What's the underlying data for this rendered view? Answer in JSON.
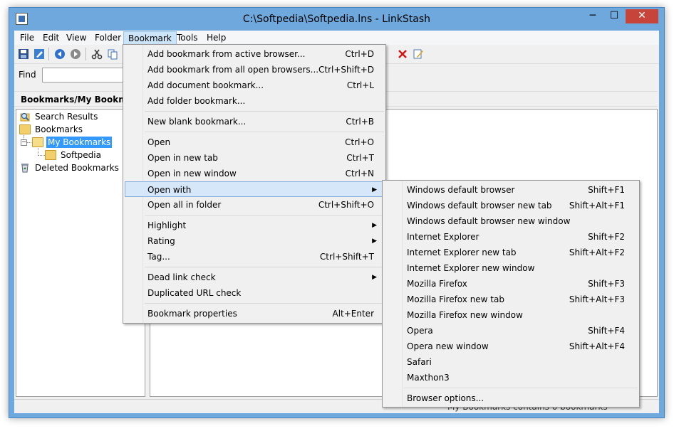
{
  "window": {
    "title": "C:\\Softpedia\\Softpedia.lns - LinkStash",
    "min_glyph": "─",
    "max_glyph": "☐",
    "close_glyph": "✕"
  },
  "menubar": [
    "File",
    "Edit",
    "View",
    "Folder",
    "Bookmark",
    "Tools",
    "Help"
  ],
  "toolbar": {
    "icons": [
      "save-icon",
      "properties-icon",
      "back-icon",
      "forward-icon",
      "cut-icon",
      "copy-icon",
      "delete-icon",
      "edit-icon"
    ]
  },
  "find": {
    "label": "Find",
    "value": ""
  },
  "tree": {
    "header": "Bookmarks/My Bookmarks",
    "items": [
      {
        "label": "Search Results",
        "icon": "search-icon"
      },
      {
        "label": "Bookmarks",
        "icon": "folder-icon"
      },
      {
        "label": "My Bookmarks",
        "icon": "folder-open-icon",
        "selected": true
      },
      {
        "label": "Softpedia",
        "icon": "folder-icon"
      },
      {
        "label": "Deleted Bookmarks",
        "icon": "recycle-icon"
      }
    ]
  },
  "status": {
    "text": "My Bookmarks contains 0 bookmarks"
  },
  "bookmark_menu": {
    "items": [
      {
        "label": "Add bookmark from active browser...",
        "shortcut": "Ctrl+D"
      },
      {
        "label": "Add bookmark from all open browsers...",
        "shortcut": "Ctrl+Shift+D"
      },
      {
        "label": "Add document bookmark...",
        "shortcut": "Ctrl+L"
      },
      {
        "label": "Add folder bookmark...",
        "shortcut": ""
      },
      {
        "label": "New blank bookmark...",
        "shortcut": "Ctrl+B"
      },
      {
        "label": "Open",
        "shortcut": "Ctrl+O"
      },
      {
        "label": "Open in new tab",
        "shortcut": "Ctrl+T"
      },
      {
        "label": "Open in new window",
        "shortcut": "Ctrl+N"
      },
      {
        "label": "Open with",
        "shortcut": "",
        "submenu": true,
        "highlighted": true
      },
      {
        "label": "Open all in folder",
        "shortcut": "Ctrl+Shift+O"
      },
      {
        "label": "Highlight",
        "shortcut": "",
        "submenu": true
      },
      {
        "label": "Rating",
        "shortcut": "",
        "submenu": true
      },
      {
        "label": "Tag...",
        "shortcut": "Ctrl+Shift+T"
      },
      {
        "label": "Dead link check",
        "shortcut": "",
        "submenu": true
      },
      {
        "label": "Duplicated URL check",
        "shortcut": ""
      },
      {
        "label": "Bookmark properties",
        "shortcut": "Alt+Enter"
      }
    ]
  },
  "open_with_menu": {
    "items": [
      {
        "label": "Windows default browser",
        "shortcut": "Shift+F1"
      },
      {
        "label": "Windows default browser new tab",
        "shortcut": "Shift+Alt+F1"
      },
      {
        "label": "Windows default browser new window",
        "shortcut": ""
      },
      {
        "label": "Internet Explorer",
        "shortcut": "Shift+F2"
      },
      {
        "label": "Internet Explorer new tab",
        "shortcut": "Shift+Alt+F2"
      },
      {
        "label": "Internet Explorer new window",
        "shortcut": ""
      },
      {
        "label": "Mozilla Firefox",
        "shortcut": "Shift+F3"
      },
      {
        "label": "Mozilla Firefox new tab",
        "shortcut": "Shift+Alt+F3"
      },
      {
        "label": "Mozilla Firefox new window",
        "shortcut": ""
      },
      {
        "label": "Opera",
        "shortcut": "Shift+F4"
      },
      {
        "label": "Opera new window",
        "shortcut": "Shift+Alt+F4"
      },
      {
        "label": "Safari",
        "shortcut": ""
      },
      {
        "label": "Maxthon3",
        "shortcut": ""
      },
      {
        "label": "Browser options...",
        "shortcut": ""
      }
    ]
  },
  "submenu_arrow": "▶",
  "colors": {
    "titlebar": "#6fa8dc",
    "close": "#c7443a",
    "selection": "#3399ff",
    "menu_highlight": "#d5e7f8"
  }
}
